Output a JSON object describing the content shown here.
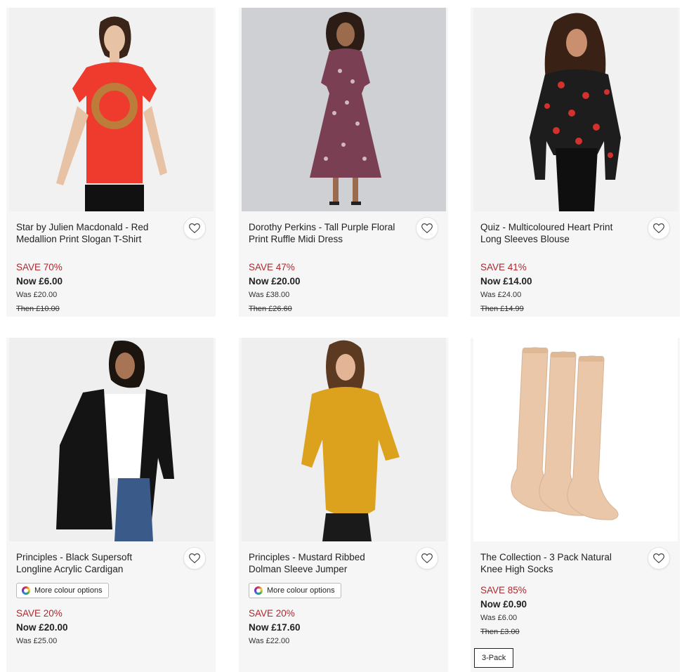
{
  "heart_icon": "heart-outline-icon",
  "colour_icon": "colour-wheel-icon",
  "colors": {
    "save": "#b0272e",
    "card_bg": "#f6f6f6"
  },
  "products": [
    {
      "title": "Star by Julien Macdonald - Red Medallion Print Slogan T-Shirt",
      "save": "SAVE 70%",
      "now": "Now £6.00",
      "was": "Was £20.00",
      "then": "Then £10.00"
    },
    {
      "title": "Dorothy Perkins - Tall Purple Floral Print Ruffle Midi Dress",
      "save": "SAVE 47%",
      "now": "Now £20.00",
      "was": "Was £38.00",
      "then": "Then £26.60"
    },
    {
      "title": "Quiz - Multicoloured Heart Print Long Sleeves Blouse",
      "save": "SAVE 41%",
      "now": "Now £14.00",
      "was": "Was £24.00",
      "then": "Then £14.99"
    },
    {
      "title": "Principles - Black Supersoft Longline Acrylic Cardigan",
      "colour_options": "More colour options",
      "save": "SAVE 20%",
      "now": "Now £20.00",
      "was": "Was £25.00"
    },
    {
      "title": "Principles - Mustard Ribbed Dolman Sleeve Jumper",
      "colour_options": "More colour options",
      "save": "SAVE 20%",
      "now": "Now £17.60",
      "was": "Was £22.00"
    },
    {
      "title": "The Collection - 3 Pack Natural Knee High Socks",
      "save": "SAVE 85%",
      "now": "Now £0.90",
      "was": "Was £6.00",
      "then": "Then £3.00",
      "badge": "3-Pack"
    }
  ]
}
